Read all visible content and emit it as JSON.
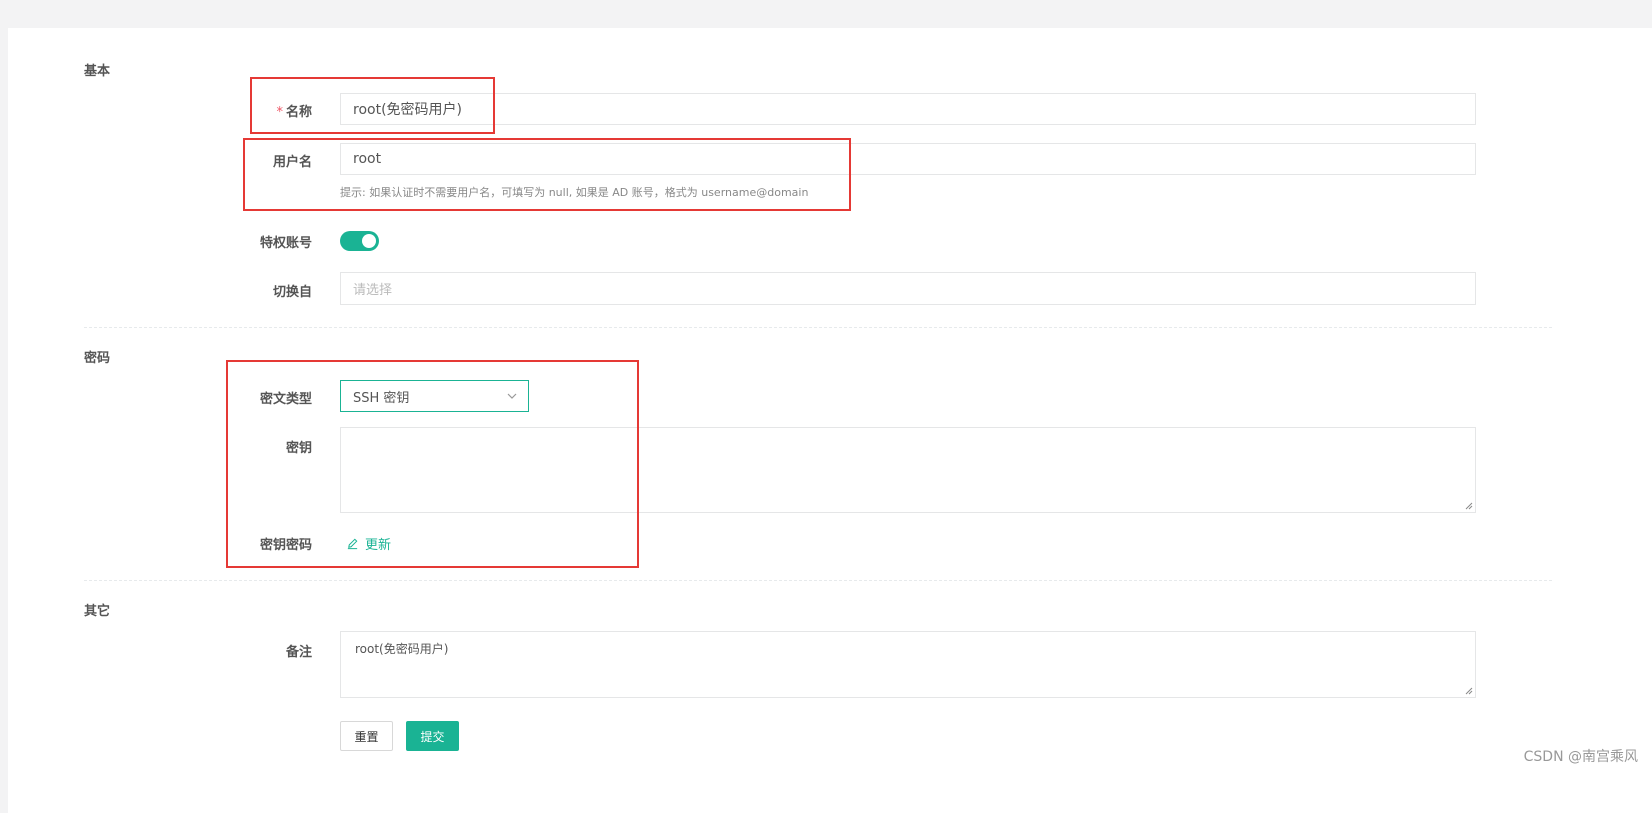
{
  "sections": {
    "basic": "基本",
    "password": "密码",
    "other": "其它"
  },
  "basic": {
    "name_label": "名称",
    "name_required_mark": "*",
    "name_value": "root(免密码用户)",
    "username_label": "用户名",
    "username_value": "root",
    "username_hint": "提示: 如果认证时不需要用户名，可填写为 null, 如果是 AD 账号，格式为 username@domain",
    "privileged_label": "特权账号",
    "privileged_on": true,
    "switch_from_label": "切换自",
    "switch_from_placeholder": "请选择"
  },
  "password": {
    "secret_type_label": "密文类型",
    "secret_type_value": "SSH 密钥",
    "key_label": "密钥",
    "key_value": "",
    "passphrase_label": "密钥密码",
    "update_link": "更新"
  },
  "other": {
    "comment_label": "备注",
    "comment_value": "root(免密码用户)"
  },
  "buttons": {
    "reset": "重置",
    "submit": "提交"
  },
  "watermark": "CSDN @南宫乘风",
  "colors": {
    "accent": "#1ab394",
    "required": "#ed5565",
    "annotation": "#e53935"
  }
}
